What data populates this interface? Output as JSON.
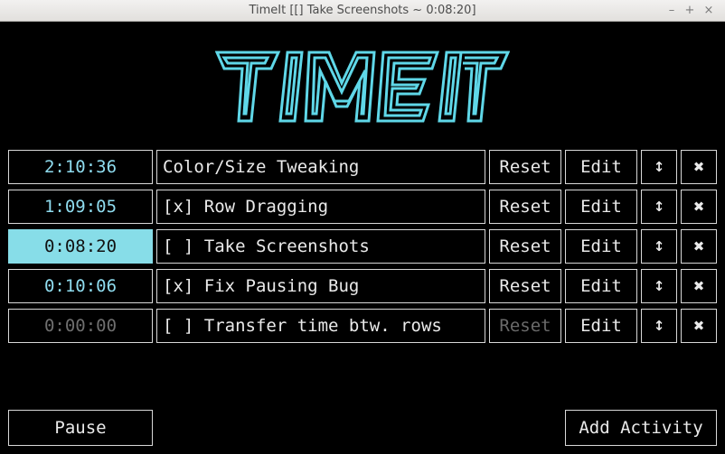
{
  "window": {
    "title": "TimeIt [[] Take Screenshots ~ 0:08:20]",
    "controls": [
      "–",
      "+",
      "×"
    ]
  },
  "logo": {
    "text": "TIMEIT",
    "color": "#5fd7e8"
  },
  "rows": [
    {
      "time": "2:10:36",
      "label": "Color/Size Tweaking",
      "reset": "Reset",
      "edit": "Edit",
      "move": "↕",
      "delete": "✖"
    },
    {
      "time": "1:09:05",
      "label": "[x] Row Dragging",
      "reset": "Reset",
      "edit": "Edit",
      "move": "↕",
      "delete": "✖"
    },
    {
      "time": "0:08:20",
      "label": "[ ] Take Screenshots",
      "reset": "Reset",
      "edit": "Edit",
      "move": "↕",
      "delete": "✖"
    },
    {
      "time": "0:10:06",
      "label": "[x] Fix Pausing Bug",
      "reset": "Reset",
      "edit": "Edit",
      "move": "↕",
      "delete": "✖"
    },
    {
      "time": "0:00:00",
      "label": "[ ] Transfer time btw. rows",
      "reset": "Reset",
      "edit": "Edit",
      "move": "↕",
      "delete": "✖"
    }
  ],
  "footer": {
    "pause_label": "Pause",
    "add_label": "Add Activity"
  },
  "colors": {
    "accent": "#87dde8",
    "timer_text": "#8fdcef",
    "border": "#d8d8d8",
    "disabled": "#6a6a6a"
  }
}
